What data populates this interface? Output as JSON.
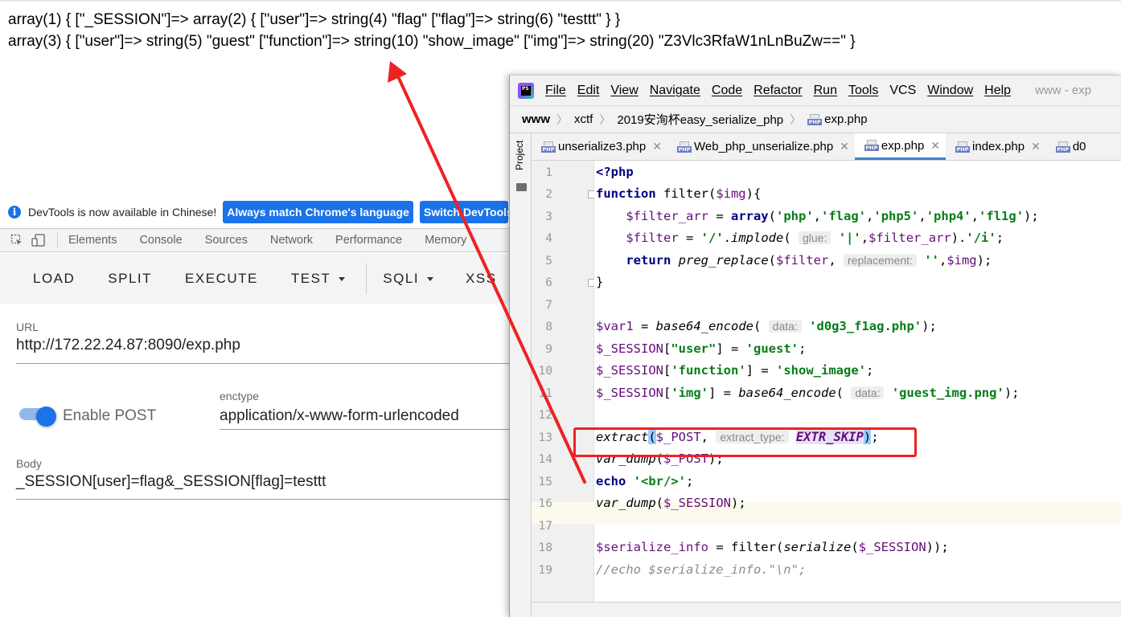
{
  "browser_output": {
    "line1": "array(1) { [\"_SESSION\"]=> array(2) { [\"user\"]=> string(4) \"flag\" [\"flag\"]=> string(6) \"testtt\" } }",
    "line2": "array(3) { [\"user\"]=> string(5) \"guest\" [\"function\"]=> string(10) \"show_image\" [\"img\"]=> string(20) \"Z3Vlc3RfaW1nLnBuZw==\" }"
  },
  "devtools": {
    "infobar_text": "DevTools is now available in Chinese!",
    "always_match_label": "Always match Chrome's language",
    "switch_label": "Switch DevTools",
    "tabs": [
      "Elements",
      "Console",
      "Sources",
      "Network",
      "Performance",
      "Memory"
    ],
    "hackbar": {
      "buttons": [
        "LOAD",
        "SPLIT",
        "EXECUTE",
        "TEST",
        "SQLI",
        "XSS"
      ],
      "url_label": "URL",
      "url_value": "http://172.22.24.87:8090/exp.php",
      "enable_post_label": "Enable POST",
      "enable_post_on": true,
      "enctype_label": "enctype",
      "enctype_value": "application/x-www-form-urlencoded",
      "body_label": "Body",
      "body_value": "_SESSION[user]=flag&_SESSION[flag]=testtt"
    }
  },
  "ide": {
    "menu": [
      "File",
      "Edit",
      "View",
      "Navigate",
      "Code",
      "Refactor",
      "Run",
      "Tools",
      "VCS",
      "Window",
      "Help"
    ],
    "window_title": "www - exp",
    "breadcrumb": [
      "www",
      "xctf",
      "2019安洵杯easy_serialize_php",
      "exp.php"
    ],
    "side_panel_label": "Project",
    "tabs": [
      {
        "label": "unserialize3.php",
        "active": false
      },
      {
        "label": "Web_php_unserialize.php",
        "active": false
      },
      {
        "label": "exp.php",
        "active": true
      },
      {
        "label": "index.php",
        "active": false
      },
      {
        "label": "d0",
        "active": false
      }
    ],
    "line_numbers": [
      "1",
      "2",
      "3",
      "4",
      "5",
      "6",
      "7",
      "8",
      "9",
      "10",
      "11",
      "12",
      "13",
      "14",
      "15",
      "16",
      "17",
      "18",
      "19"
    ],
    "hints": {
      "glue": "glue:",
      "replacement": "replacement:",
      "data": "data:",
      "extract_type": "extract_type:"
    },
    "code": {
      "l1": "<?php",
      "l2_kw": "function",
      "l2_rest": " filter(",
      "l2_var": "$img",
      "l2_end": "){",
      "l3_var": "$filter_arr",
      "l3_eq": " = ",
      "l3_kw": "array",
      "l3_s1": "'php'",
      "l3_s2": "'flag'",
      "l3_s3": "'php5'",
      "l3_s4": "'php4'",
      "l3_s5": "'fl1g'",
      "l4_var": "$filter",
      "l4_s1": "'/'",
      "l4_fn": "implode",
      "l4_s2": "'|'",
      "l4_var2": "$filter_arr",
      "l4_s3": "'/i'",
      "l5_kw": "return",
      "l5_fn": "preg_replace",
      "l5_var": "$filter",
      "l5_s": "''",
      "l5_var2": "$img",
      "l6": "}",
      "l8_var": "$var1",
      "l8_fn": "base64_encode",
      "l8_s": "'d0g3_f1ag.php'",
      "l9_var": "$_SESSION",
      "l9_key": "\"user\"",
      "l9_s": "'guest'",
      "l10_key": "'function'",
      "l10_s": "'show_image'",
      "l11_key": "'img'",
      "l11_fn": "base64_encode",
      "l11_s": "'guest_img.png'",
      "l13_fn": "extract",
      "l13_var": "$_POST",
      "l13_const": "EXTR_SKIP",
      "l14_fn": "var_dump",
      "l14_var": "$_POST",
      "l15_kw": "echo",
      "l15_s": "'<br/>'",
      "l16_fn": "var_dump",
      "l16_var": "$_SESSION",
      "l18_var": "$serialize_info",
      "l18_fn": "filter",
      "l18_fn2": "serialize",
      "l18_var2": "$_SESSION",
      "l19": "//echo $serialize_info.\"\\n\";"
    }
  },
  "colors": {
    "annotation_red": "#ee2222",
    "hackbar_blue": "#1a73e8",
    "active_tab_underline": "#4083c9"
  }
}
